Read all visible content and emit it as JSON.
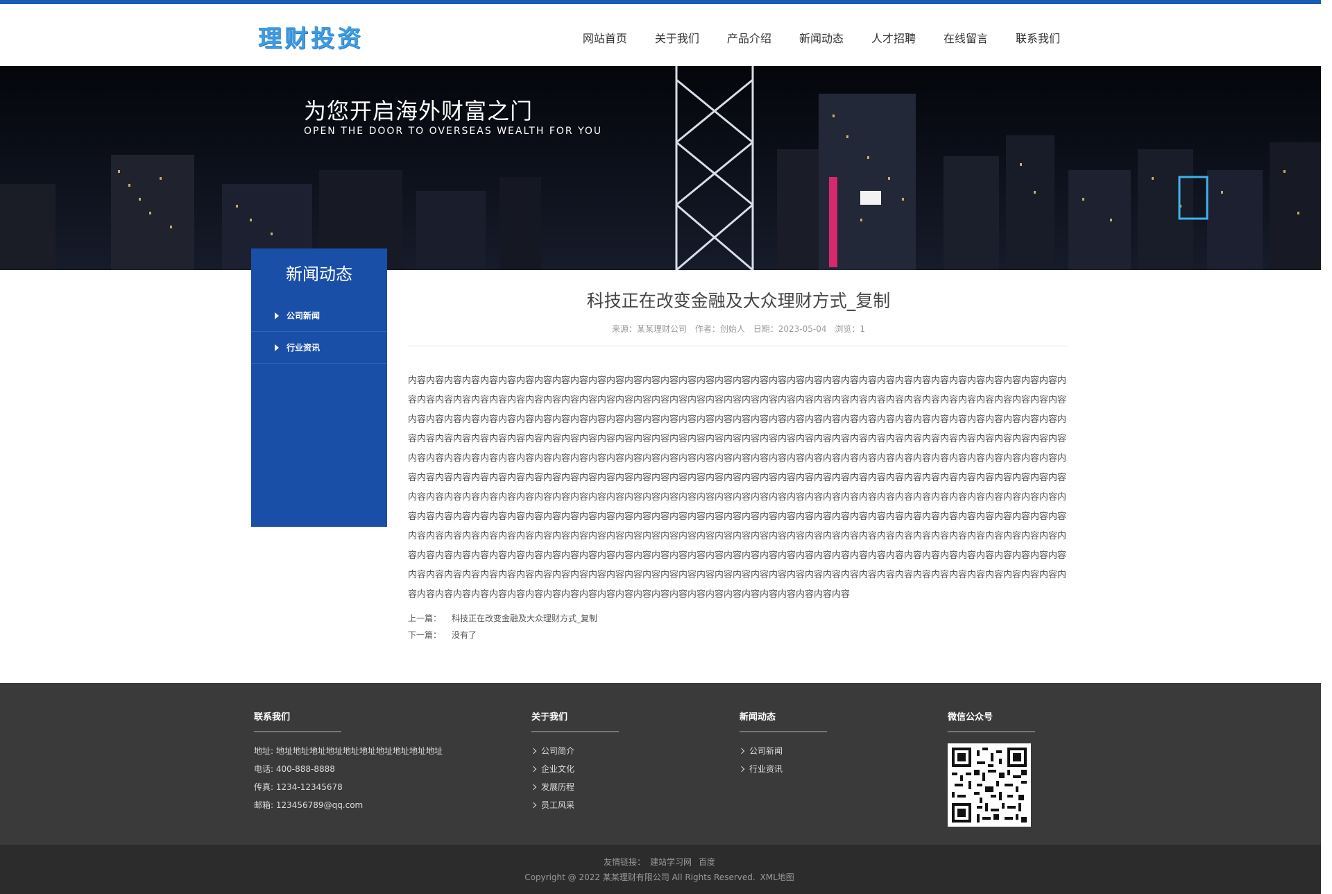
{
  "header": {
    "logo": "理财投资",
    "nav": [
      "网站首页",
      "关于我们",
      "产品介绍",
      "新闻动态",
      "人才招聘",
      "在线留言",
      "联系我们"
    ]
  },
  "banner": {
    "title": "为您开启海外财富之门",
    "subtitle": "OPEN THE DOOR TO OVERSEAS WEALTH FOR YOU"
  },
  "sidebar": {
    "title": "新闻动态",
    "items": [
      "公司新闻",
      "行业资讯"
    ]
  },
  "article": {
    "title": "科技正在改变金融及大众理财方式_复制",
    "meta": {
      "source": "来源：某某理财公司",
      "author": "作者：创始人",
      "date": "日期：2023-05-04",
      "views": "浏览：1"
    },
    "body": "内容内容内容内容内容内容内容内容内容内容内容内容内容内容内容内容内容内容内容内容内容内容内容内容内容内容内容内容内容内容内容内容内容内容内容内容内容内容内容内容内容内容内容内容内容内容内容内容内容内容内容内容内容内容内容内容内容内容内容内容内容内容内容内容内容内容内容内容内容内容内容内容内容内容内容内容内容内容内容内容内容内容内容内容内容内容内容内容内容内容内容内容内容内容内容内容内容内容内容内容内容内容内容内容内容内容内容内容内容内容内容内容内容内容内容内容内容内容内容内容内容内容内容内容内容内容内容内容内容内容内容内容内容内容内容内容内容内容内容内容内容内容内容内容内容内容内容内容内容内容内容内容内容内容内容内容内容内容内容内容内容内容内容内容内容内容内容内容内容内容内容内容内容内容内容内容内容内容内容内容内容内容内容内容内容内容内容内容内容内容内容内容内容内容内容内容内容内容内容内容内容内容内容内容内容内容内容内容内容内容内容内容内容内容内容内容内容内容内容内容内容内容内容内容内容内容内容内容内容内容内容内容内容内容内容内容内容内容内容内容内容内容内容内容内容内容内容内容内容内容内容内容内容内容内容内容内容内容内容内容内容内容内容内容内容内容内容内容内容内容内容内容内容内容内容内容内容内容内容内容内容内容内容内容内容内容内容内容内容内容内容内容内容内容内容内容内容内容内容内容内容内容内容内容内容内容内容内容内容内容内容内容内容内容内容内容内容内容内容内容内容内容内容内容内容内容内容内容内容内容内容内容内容内容内容内容内容内容内容内容内容内容内容内容内容内容内容内容内容内容内容内容内容内容内容内容内容内容内容内容内容内容内容内容内容内容内容内容内容内容内容内容内容内容内容内容内容内容内容内容内容内容内容内容内容内容内容内容内容内容内容内容内容内容内容内容内容内容内容内容内容内容内容内容内容内容内容内容内容内容内容内容内容内容内容内容内容内容内容内容内容内容内容内容内容内容",
    "prev_label": "上一篇：",
    "prev_value": "科技正在改变金融及大众理财方式_复制",
    "next_label": "下一篇：",
    "next_value": "没有了"
  },
  "footer": {
    "contact": {
      "title": "联系我们",
      "address": "地址: 地址地址地址地址地址地址地址地址地址地址",
      "phone": "电话: 400-888-8888",
      "fax": "传真: 1234-12345678",
      "email": "邮箱: 123456789@qq.com"
    },
    "about": {
      "title": "关于我们",
      "links": [
        "公司简介",
        "企业文化",
        "发展历程",
        "员工风采"
      ]
    },
    "news": {
      "title": "新闻动态",
      "links": [
        "公司新闻",
        "行业资讯"
      ]
    },
    "wechat": {
      "title": "微信公众号"
    },
    "friend_label": "友情链接：",
    "friend_links": [
      "建站学习网",
      "百度"
    ],
    "copyright": "Copyright @ 2022 某某理财有限公司 All Rights Reserved.",
    "sitemap": "XML地图"
  }
}
